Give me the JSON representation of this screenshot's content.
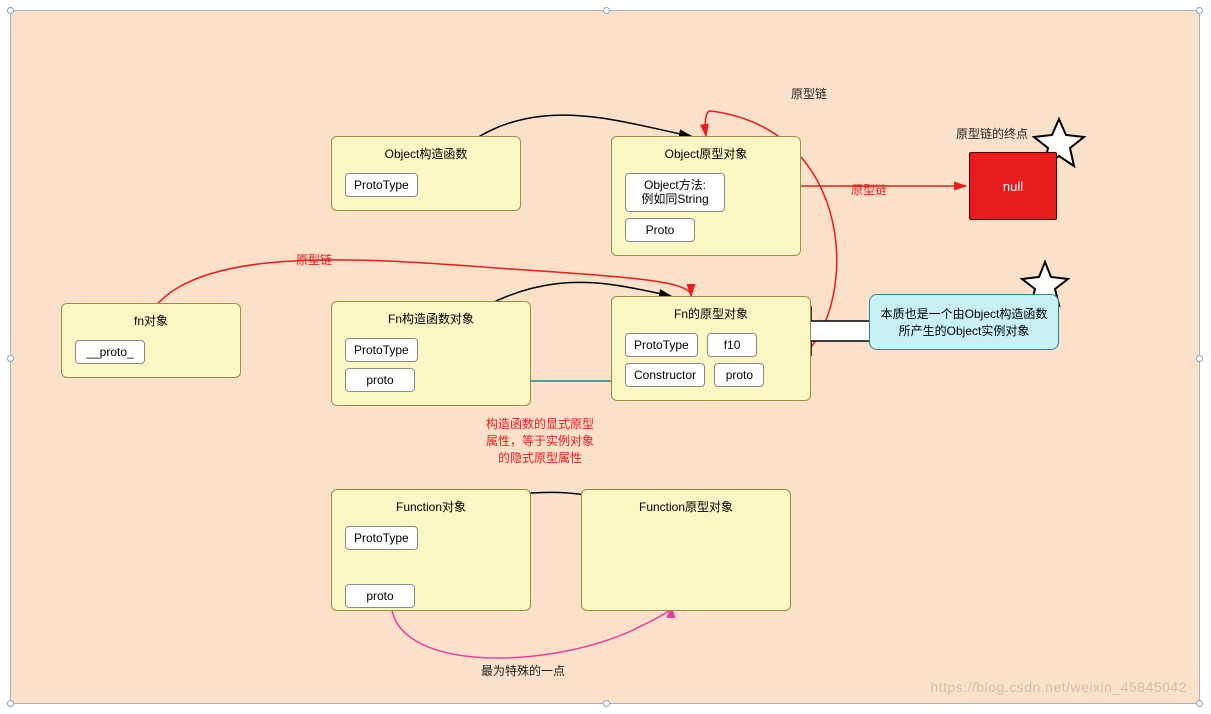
{
  "boxes": {
    "object_ctor": {
      "title": "Object构造函数",
      "slots": {
        "prototype": "ProtoType"
      }
    },
    "object_proto": {
      "title": "Object原型对象",
      "slots": {
        "methods": "Object方法:\n例如同String",
        "proto": "Proto"
      }
    },
    "null": {
      "label": "null"
    },
    "fn_instance": {
      "title": "fn对象",
      "slots": {
        "proto": "__proto_"
      }
    },
    "fn_ctor": {
      "title": "Fn构造函数对象",
      "slots": {
        "prototype": "ProtoType",
        "proto": "proto"
      }
    },
    "fn_proto": {
      "title": "Fn的原型对象",
      "slots": {
        "prototype": "ProtoType",
        "f10": "f10",
        "constructor": "Constructor",
        "proto": "proto"
      }
    },
    "cyan": "本质也是一个由Object构造函数所产生的Object实例对象",
    "function_obj": {
      "title": "Function对象",
      "slots": {
        "prototype": "ProtoType",
        "proto": "proto"
      }
    },
    "function_proto": {
      "title": "Function原型对象"
    }
  },
  "labels": {
    "chain_top": "原型链",
    "chain_red_topleft": "原型链",
    "chain_red_mid": "原型链",
    "terminal": "原型链的终点",
    "ctor_explicit": "构造函数的显式原型\n属性，等于实例对象\n的隐式原型属性",
    "special": "最为特殊的一点"
  },
  "watermark": "https://blog.csdn.net/weixin_45845042"
}
